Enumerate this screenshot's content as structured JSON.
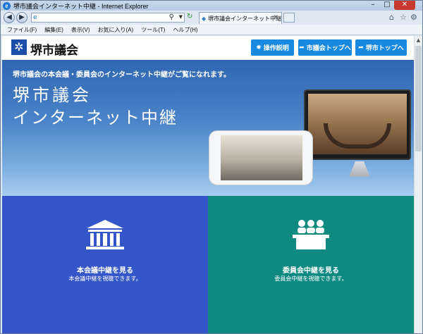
{
  "browser": {
    "window_title": "堺市議会インターネット中継 - Internet Explorer",
    "address_value": "",
    "tab_label": "堺市議会インターネット中継",
    "menu": [
      "ファイル(F)",
      "編集(E)",
      "表示(V)",
      "お気に入り(A)",
      "ツール(T)",
      "ヘルプ(H)"
    ]
  },
  "site": {
    "logo_text": "堺市議会",
    "buttons": [
      {
        "label": "操作説明",
        "icon": "gear-icon"
      },
      {
        "label": "市議会トップへ",
        "icon": "arrow-icon"
      },
      {
        "label": "堺市トップへ",
        "icon": "arrow-icon"
      }
    ],
    "hero": {
      "lead": "堺市議会の本会議・委員会のインターネット中継がご覧になれます。",
      "title_line1": "堺市議会",
      "title_line2": "インターネット中継"
    },
    "tiles": [
      {
        "title": "本会議中継を見る",
        "subtitle": "本会議中継を視聴できます。",
        "icon": "assembly-hall-icon"
      },
      {
        "title": "委員会中継を見る",
        "subtitle": "委員会中継を視聴できます。",
        "icon": "committee-icon"
      }
    ]
  },
  "colors": {
    "button_blue": "#1a8ae0",
    "tile_left": "#3556c8",
    "tile_right": "#0e8a80"
  }
}
